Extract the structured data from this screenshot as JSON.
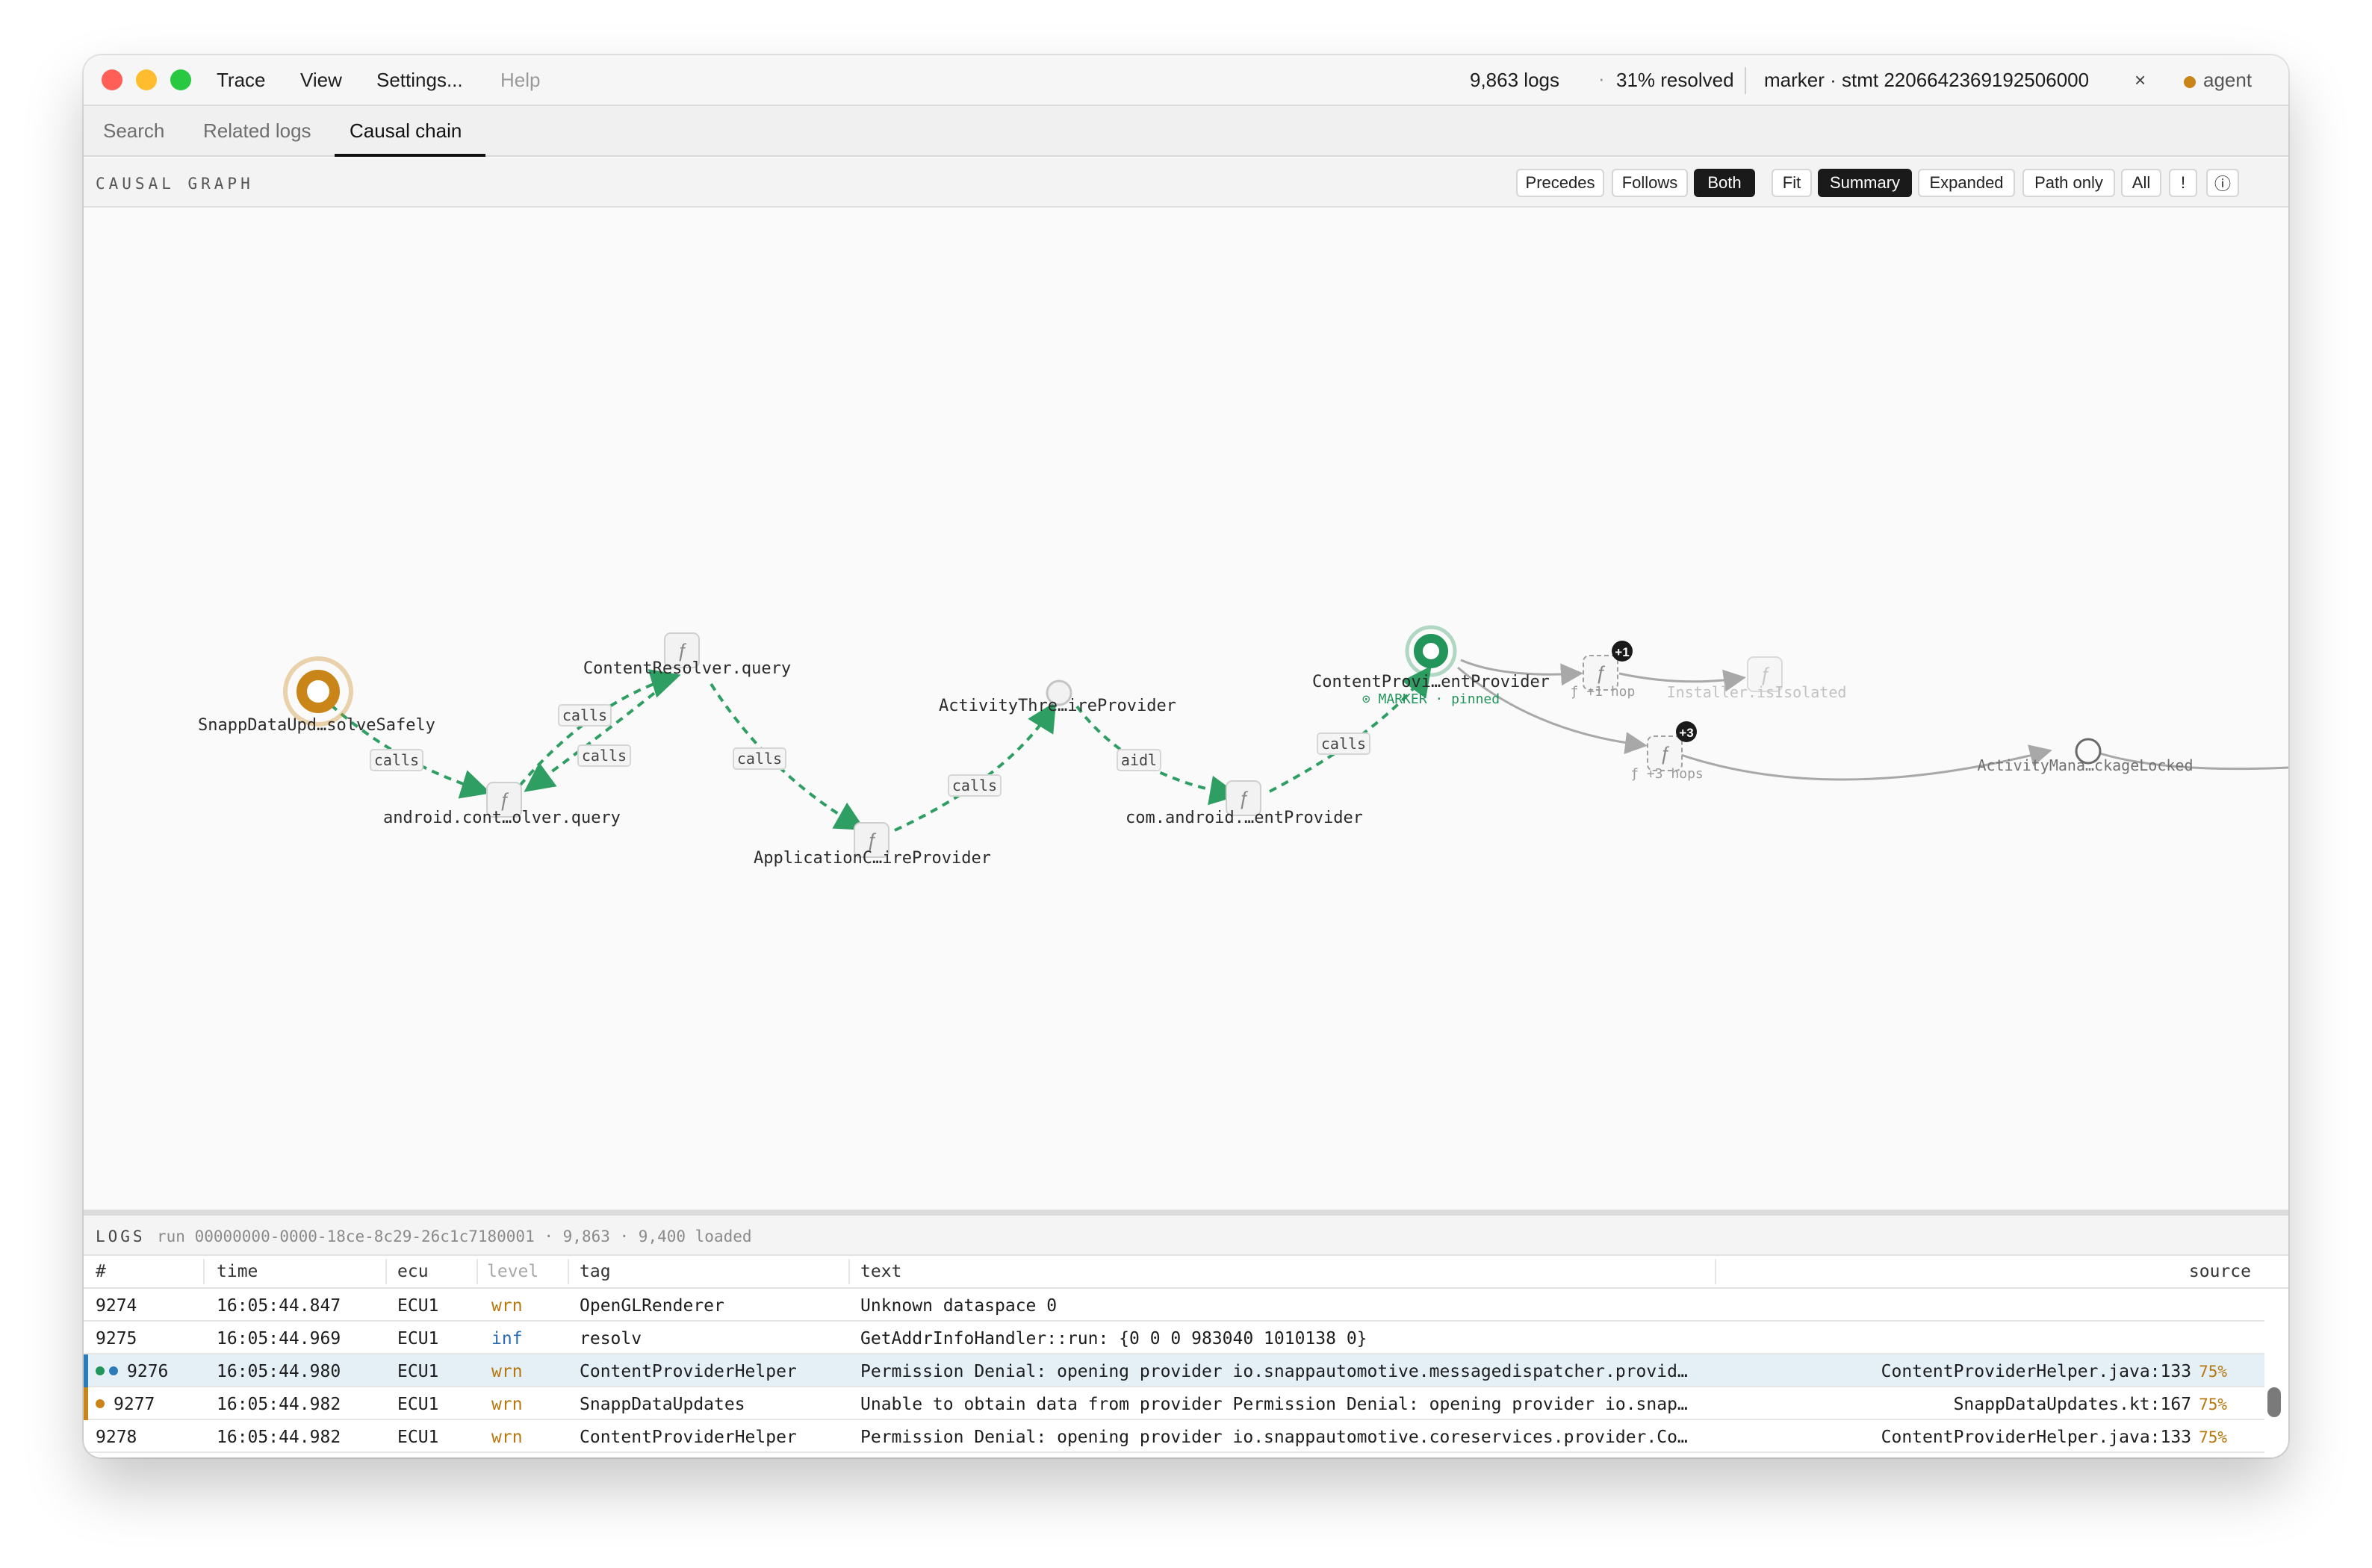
{
  "menubar": {
    "items": [
      "Trace",
      "View",
      "Settings...",
      "Help"
    ],
    "log_count": "9,863 logs",
    "separator": "·",
    "resolved": "31% resolved",
    "marker": "marker · stmt 2206642369192506000",
    "marker_close": "×",
    "agent": "agent"
  },
  "tabs": [
    "Search",
    "Related logs",
    "Causal chain"
  ],
  "graph": {
    "title": "CAUSAL GRAPH",
    "buttons": [
      "Precedes",
      "Follows",
      "Both",
      "Fit",
      "Summary",
      "Expanded",
      "Path only",
      "All",
      "!",
      "ⓘ"
    ],
    "active_buttons": [
      "Both",
      "Summary"
    ],
    "nodes": {
      "snapp": "SnappDataUpd…solveSafely",
      "android_query": "android.cont…olver.query",
      "content_resolver": "ContentResolver.query",
      "app_provider": "ApplicationC…ireProvider",
      "activity_thread": "ActivityThre…ireProvider",
      "com_android": "com.android.…entProvider",
      "content_provider": "ContentProvi…entProvider",
      "marker_label": "⊙ MARKER · pinned",
      "hop1": "ƒ +1 hop",
      "hop3": "ƒ +3 hops",
      "installer": "Installer.isIsolated",
      "activity_mana": "ActivityMana…ckageLocked"
    },
    "badges": {
      "hop1": "+1",
      "hop3": "+3"
    },
    "edge_labels": [
      "calls",
      "calls",
      "calls",
      "calls",
      "calls",
      "aidl",
      "calls"
    ],
    "function_glyph": "ƒ"
  },
  "logs": {
    "title": "LOGS",
    "meta": "run 00000000-0000-18ce-8c29-26c1c7180001 · 9,863 · 9,400 loaded",
    "columns": [
      "#",
      "time",
      "ecu",
      "level",
      "tag",
      "text",
      "source"
    ],
    "rows": [
      {
        "id": "9274",
        "time": "16:05:44.847",
        "ecu": "ECU1",
        "level": "wrn",
        "tag": "OpenGLRenderer",
        "text": "Unknown dataspace 0",
        "source": "",
        "pct": ""
      },
      {
        "id": "9275",
        "time": "16:05:44.969",
        "ecu": "ECU1",
        "level": "inf",
        "tag": "resolv",
        "text": "GetAddrInfoHandler::run: {0 0 0 983040 1010138 0}",
        "source": "",
        "pct": ""
      },
      {
        "id": "9276",
        "time": "16:05:44.980",
        "ecu": "ECU1",
        "level": "wrn",
        "tag": "ContentProviderHelper",
        "text": "Permission Denial: opening provider io.snappautomotive.messagedispatcher.provid…",
        "source": "ContentProviderHelper.java:133",
        "pct": "75%"
      },
      {
        "id": "9277",
        "time": "16:05:44.982",
        "ecu": "ECU1",
        "level": "wrn",
        "tag": "SnappDataUpdates",
        "text": "Unable to obtain data from provider Permission Denial: opening provider io.snap…",
        "source": "SnappDataUpdates.kt:167",
        "pct": "75%"
      },
      {
        "id": "9278",
        "time": "16:05:44.982",
        "ecu": "ECU1",
        "level": "wrn",
        "tag": "ContentProviderHelper",
        "text": "Permission Denial: opening provider io.snappautomotive.coreservices.provider.Co…",
        "source": "ContentProviderHelper.java:133",
        "pct": "75%"
      }
    ]
  },
  "colors": {
    "edge_green": "#2e9e62",
    "marker_green": "#21955a",
    "origin_amber": "#c98518",
    "wrn": "#b7770c",
    "inf": "#2b6cb0",
    "selected_row": "#e4f0f6"
  }
}
